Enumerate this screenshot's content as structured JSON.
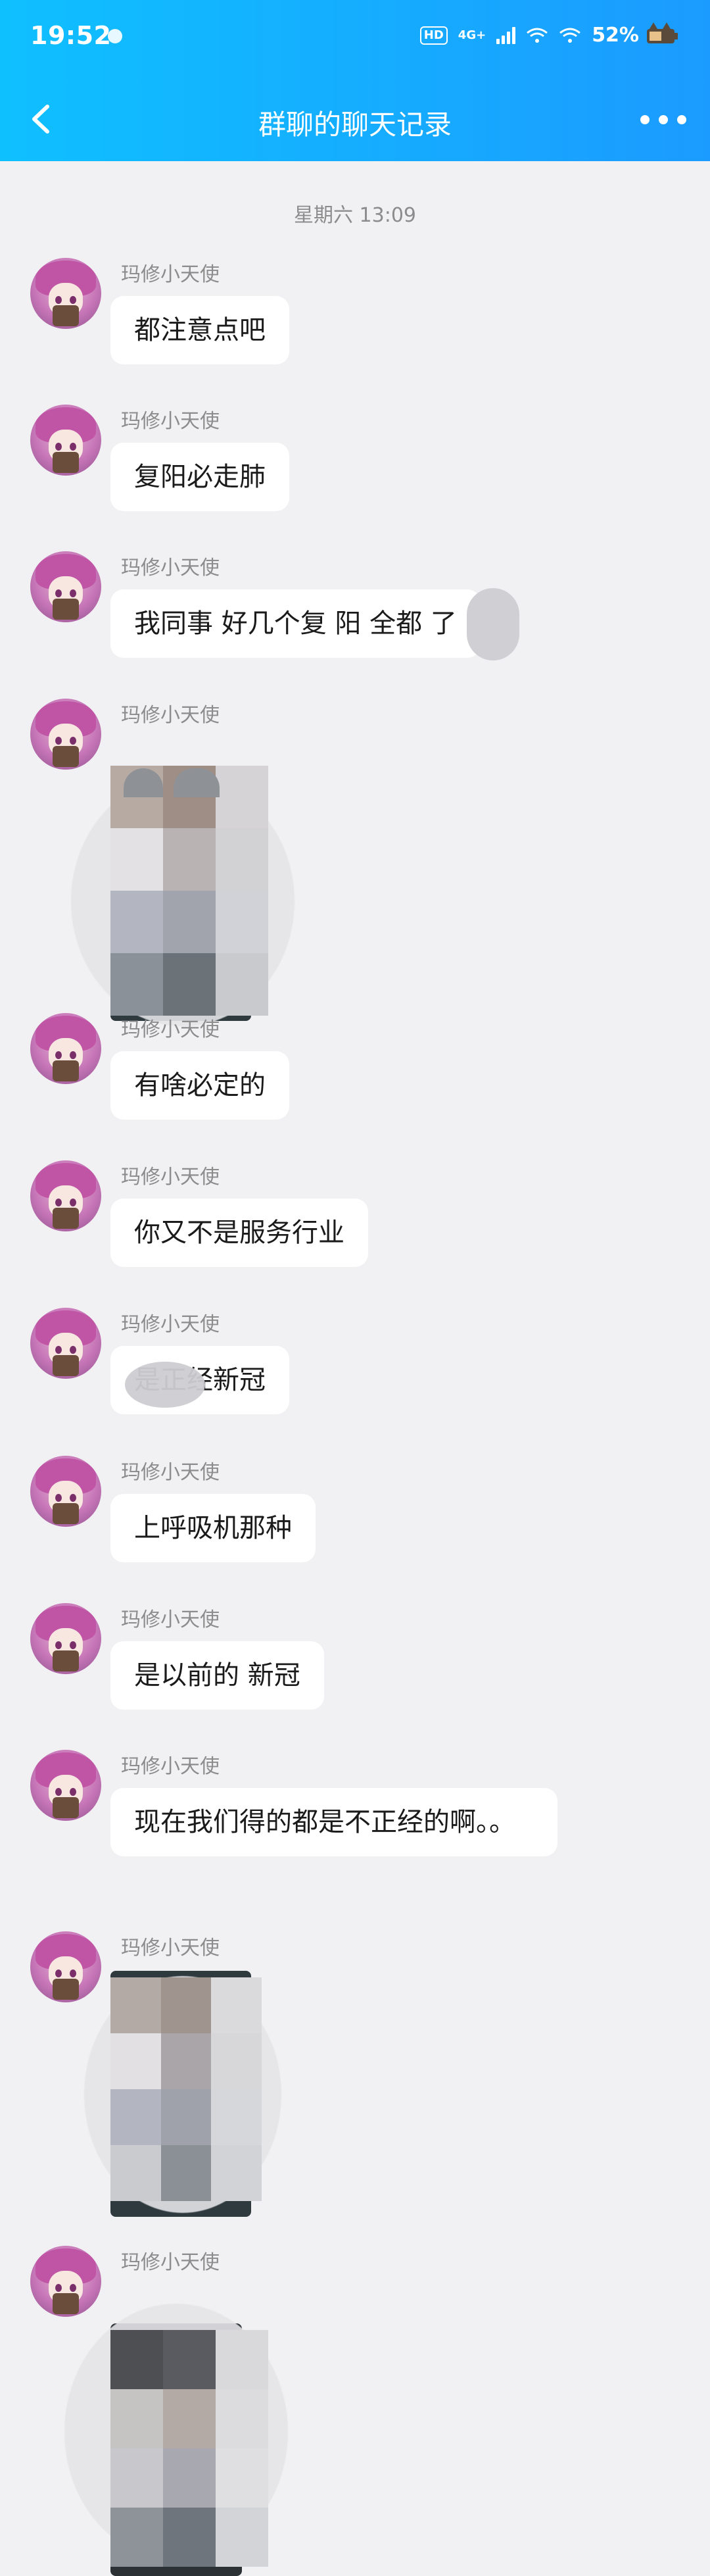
{
  "status": {
    "time": "19:52",
    "hd": "HD",
    "network": "4G+",
    "battery": "52%",
    "icons": [
      "flame-icon",
      "signal-icon",
      "wifi-icon",
      "wifi-icon",
      "battery-cat-icon"
    ]
  },
  "nav": {
    "title": "群聊的聊天记录",
    "back_icon": "chevron-left-icon",
    "more_icon": "more-dots-icon"
  },
  "chat": {
    "timestamp": "星期六 13:09",
    "sender": "玛修小天使",
    "messages": [
      {
        "type": "text",
        "text": "都注意点吧"
      },
      {
        "type": "text",
        "text": "复阳必走肺"
      },
      {
        "type": "text",
        "text": "我同事 好几个复 阳 全都  了"
      },
      {
        "type": "image",
        "content": "pixelated-image"
      },
      {
        "type": "text",
        "text": "有啥必定的"
      },
      {
        "type": "text",
        "text": "你又不是服务行业"
      },
      {
        "type": "text",
        "text": "  是正经新冠"
      },
      {
        "type": "text",
        "text": "上呼吸机那种"
      },
      {
        "type": "text",
        "text": "是以前的 新冠"
      },
      {
        "type": "text",
        "text": "现在我们得的都是不正经的啊。。"
      },
      {
        "type": "image",
        "content": "pixelated-image"
      },
      {
        "type": "image",
        "content": "pixelated-image"
      }
    ]
  },
  "colors": {
    "header_start": "#0fc0ff",
    "header_end": "#1b9bff",
    "background": "#f1f1f3",
    "bubble": "#ffffff"
  }
}
